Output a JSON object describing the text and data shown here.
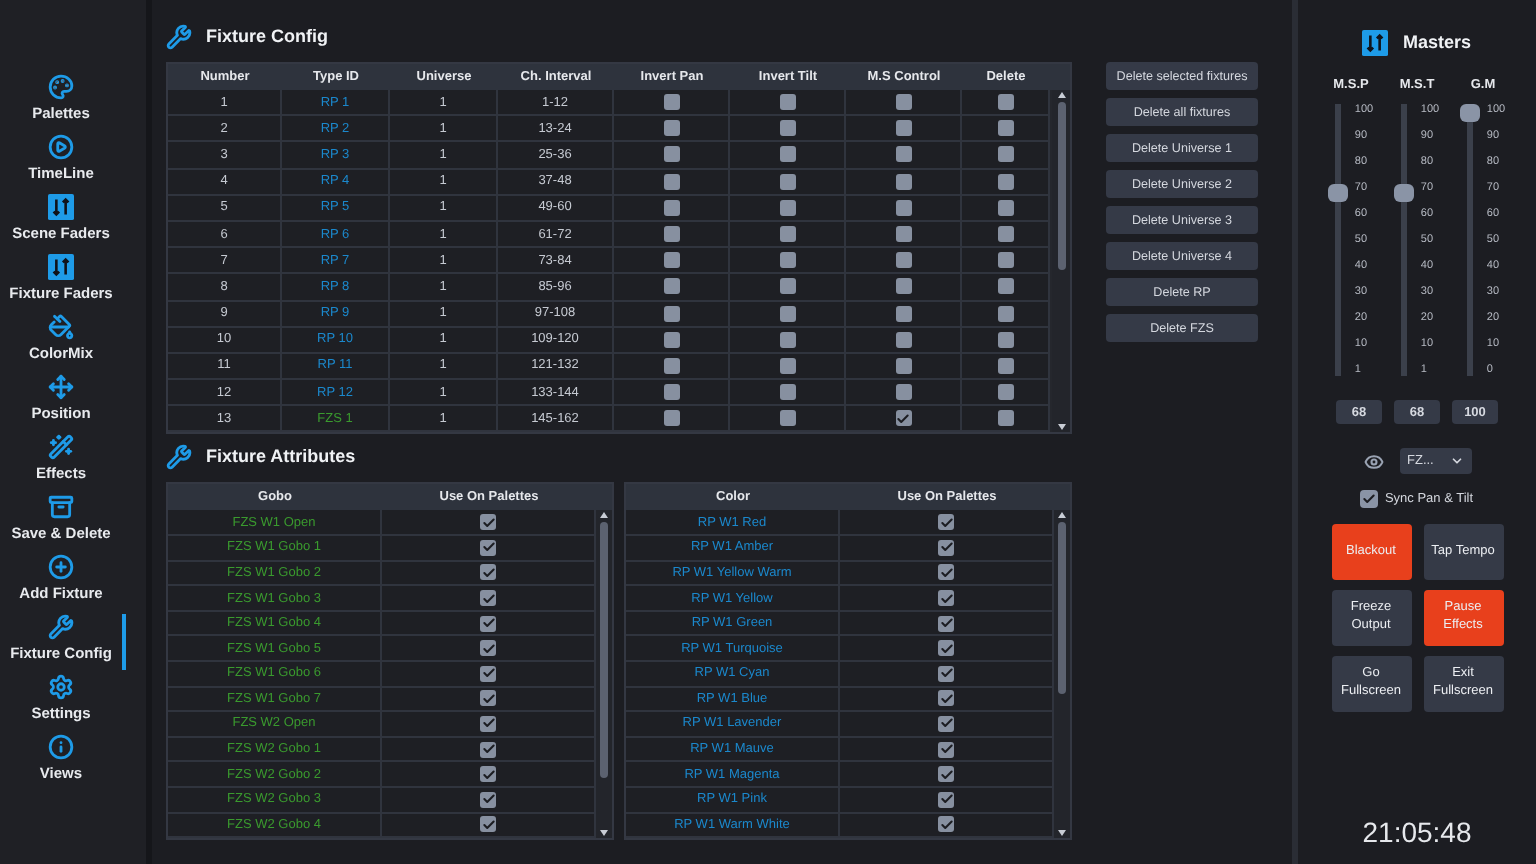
{
  "sidebar": {
    "items": [
      {
        "kind": "palette",
        "label": "Palettes",
        "selected": false
      },
      {
        "kind": "play",
        "label": "TimeLine",
        "selected": false
      },
      {
        "kind": "faders",
        "label": "Scene Faders",
        "selected": false
      },
      {
        "kind": "faders",
        "label": "Fixture Faders",
        "selected": false
      },
      {
        "kind": "bucket",
        "label": "ColorMix",
        "selected": false
      },
      {
        "kind": "position",
        "label": "Position",
        "selected": false
      },
      {
        "kind": "wand",
        "label": "Effects",
        "selected": false
      },
      {
        "kind": "archive",
        "label": "Save & Delete",
        "selected": false
      },
      {
        "kind": "plus",
        "label": "Add Fixture",
        "selected": false
      },
      {
        "kind": "wrench",
        "label": "Fixture Config",
        "selected": true
      },
      {
        "kind": "gear",
        "label": "Settings",
        "selected": false
      },
      {
        "kind": "info",
        "label": "Views",
        "selected": false
      }
    ]
  },
  "fixture_config": {
    "title": "Fixture Config",
    "columns": [
      "Number",
      "Type ID",
      "Universe",
      "Ch. Interval",
      "Invert Pan",
      "Invert Tilt",
      "M.S Control",
      "Delete"
    ],
    "rows": [
      {
        "number": "1",
        "type_id": "RP 1",
        "color": "#1b88cc",
        "universe": "1",
        "interval": "1-12",
        "invert_pan": false,
        "invert_tilt": false,
        "ms_control": false,
        "delete": false
      },
      {
        "number": "2",
        "type_id": "RP 2",
        "color": "#1b88cc",
        "universe": "1",
        "interval": "13-24",
        "invert_pan": false,
        "invert_tilt": false,
        "ms_control": false,
        "delete": false
      },
      {
        "number": "3",
        "type_id": "RP 3",
        "color": "#1b88cc",
        "universe": "1",
        "interval": "25-36",
        "invert_pan": false,
        "invert_tilt": false,
        "ms_control": false,
        "delete": false
      },
      {
        "number": "4",
        "type_id": "RP 4",
        "color": "#1b88cc",
        "universe": "1",
        "interval": "37-48",
        "invert_pan": false,
        "invert_tilt": false,
        "ms_control": false,
        "delete": false
      },
      {
        "number": "5",
        "type_id": "RP 5",
        "color": "#1b88cc",
        "universe": "1",
        "interval": "49-60",
        "invert_pan": false,
        "invert_tilt": false,
        "ms_control": false,
        "delete": false
      },
      {
        "number": "6",
        "type_id": "RP 6",
        "color": "#1b88cc",
        "universe": "1",
        "interval": "61-72",
        "invert_pan": false,
        "invert_tilt": false,
        "ms_control": false,
        "delete": false
      },
      {
        "number": "7",
        "type_id": "RP 7",
        "color": "#1b88cc",
        "universe": "1",
        "interval": "73-84",
        "invert_pan": false,
        "invert_tilt": false,
        "ms_control": false,
        "delete": false
      },
      {
        "number": "8",
        "type_id": "RP 8",
        "color": "#1b88cc",
        "universe": "1",
        "interval": "85-96",
        "invert_pan": false,
        "invert_tilt": false,
        "ms_control": false,
        "delete": false
      },
      {
        "number": "9",
        "type_id": "RP 9",
        "color": "#1b88cc",
        "universe": "1",
        "interval": "97-108",
        "invert_pan": false,
        "invert_tilt": false,
        "ms_control": false,
        "delete": false
      },
      {
        "number": "10",
        "type_id": "RP 10",
        "color": "#1b88cc",
        "universe": "1",
        "interval": "109-120",
        "invert_pan": false,
        "invert_tilt": false,
        "ms_control": false,
        "delete": false
      },
      {
        "number": "11",
        "type_id": "RP 11",
        "color": "#1b88cc",
        "universe": "1",
        "interval": "121-132",
        "invert_pan": false,
        "invert_tilt": false,
        "ms_control": false,
        "delete": false
      },
      {
        "number": "12",
        "type_id": "RP 12",
        "color": "#1b88cc",
        "universe": "1",
        "interval": "133-144",
        "invert_pan": false,
        "invert_tilt": false,
        "ms_control": false,
        "delete": false
      },
      {
        "number": "13",
        "type_id": "FZS 1",
        "color": "#3a9a2e",
        "universe": "1",
        "interval": "145-162",
        "invert_pan": false,
        "invert_tilt": false,
        "ms_control": true,
        "delete": false
      }
    ]
  },
  "actions": [
    "Delete selected fixtures",
    "Delete all fixtures",
    "Delete Universe 1",
    "Delete Universe 2",
    "Delete Universe 3",
    "Delete Universe 4",
    "Delete RP",
    "Delete FZS"
  ],
  "attributes": {
    "title": "Fixture Attributes",
    "tables": [
      {
        "columns": [
          "Gobo",
          "Use On Palettes"
        ],
        "rows": [
          {
            "name": "FZS W1 Open",
            "color": "#3a9a2e",
            "use": true
          },
          {
            "name": "FZS W1 Gobo 1",
            "color": "#3a9a2e",
            "use": true
          },
          {
            "name": "FZS W1 Gobo 2",
            "color": "#3a9a2e",
            "use": true
          },
          {
            "name": "FZS W1 Gobo 3",
            "color": "#3a9a2e",
            "use": true
          },
          {
            "name": "FZS W1 Gobo 4",
            "color": "#3a9a2e",
            "use": true
          },
          {
            "name": "FZS W1 Gobo 5",
            "color": "#3a9a2e",
            "use": true
          },
          {
            "name": "FZS W1 Gobo 6",
            "color": "#3a9a2e",
            "use": true
          },
          {
            "name": "FZS W1 Gobo 7",
            "color": "#3a9a2e",
            "use": true
          },
          {
            "name": "FZS W2 Open",
            "color": "#3a9a2e",
            "use": true
          },
          {
            "name": "FZS W2 Gobo 1",
            "color": "#3a9a2e",
            "use": true
          },
          {
            "name": "FZS W2 Gobo 2",
            "color": "#3a9a2e",
            "use": true
          },
          {
            "name": "FZS W2 Gobo 3",
            "color": "#3a9a2e",
            "use": true
          },
          {
            "name": "FZS W2 Gobo 4",
            "color": "#3a9a2e",
            "use": true
          }
        ]
      },
      {
        "columns": [
          "Color",
          "Use On Palettes"
        ],
        "rows": [
          {
            "name": "RP W1 Red",
            "color": "#1b88cc",
            "use": true
          },
          {
            "name": "RP W1 Amber",
            "color": "#1b88cc",
            "use": true
          },
          {
            "name": "RP W1 Yellow Warm",
            "color": "#1b88cc",
            "use": true
          },
          {
            "name": "RP W1 Yellow",
            "color": "#1b88cc",
            "use": true
          },
          {
            "name": "RP W1 Green",
            "color": "#1b88cc",
            "use": true
          },
          {
            "name": "RP W1 Turquoise",
            "color": "#1b88cc",
            "use": true
          },
          {
            "name": "RP W1 Cyan",
            "color": "#1b88cc",
            "use": true
          },
          {
            "name": "RP W1 Blue",
            "color": "#1b88cc",
            "use": true
          },
          {
            "name": "RP W1 Lavender",
            "color": "#1b88cc",
            "use": true
          },
          {
            "name": "RP W1 Mauve",
            "color": "#1b88cc",
            "use": true
          },
          {
            "name": "RP W1 Magenta",
            "color": "#1b88cc",
            "use": true
          },
          {
            "name": "RP W1 Pink",
            "color": "#1b88cc",
            "use": true
          },
          {
            "name": "RP W1 Warm White",
            "color": "#1b88cc",
            "use": true
          }
        ]
      }
    ]
  },
  "masters": {
    "title": "Masters",
    "faders": [
      {
        "label": "M.S.P",
        "level": 0.68,
        "ticks": [
          "100",
          "90",
          "80",
          "70",
          "60",
          "50",
          "40",
          "30",
          "20",
          "10",
          "1"
        ],
        "value": "68"
      },
      {
        "label": "M.S.T",
        "level": 0.68,
        "ticks": [
          "100",
          "90",
          "80",
          "70",
          "60",
          "50",
          "40",
          "30",
          "20",
          "10",
          "1"
        ],
        "value": "68"
      },
      {
        "label": "G.M",
        "level": 1,
        "ticks": [
          "100",
          "90",
          "80",
          "70",
          "60",
          "50",
          "40",
          "30",
          "20",
          "10",
          "0"
        ],
        "value": "100"
      }
    ],
    "fixture_select": "FZ...",
    "sync": {
      "label": "Sync Pan & Tilt",
      "checked": true
    },
    "buttons": [
      {
        "label": "Blackout",
        "on": true
      },
      {
        "label": "Tap Tempo",
        "on": false
      },
      {
        "label": "Freeze Output",
        "on": false
      },
      {
        "label": "Pause Effects",
        "on": true
      },
      {
        "label": "Go Fullscreen",
        "on": false
      },
      {
        "label": "Exit Fullscreen",
        "on": false
      }
    ],
    "clock": "21:05:48"
  }
}
